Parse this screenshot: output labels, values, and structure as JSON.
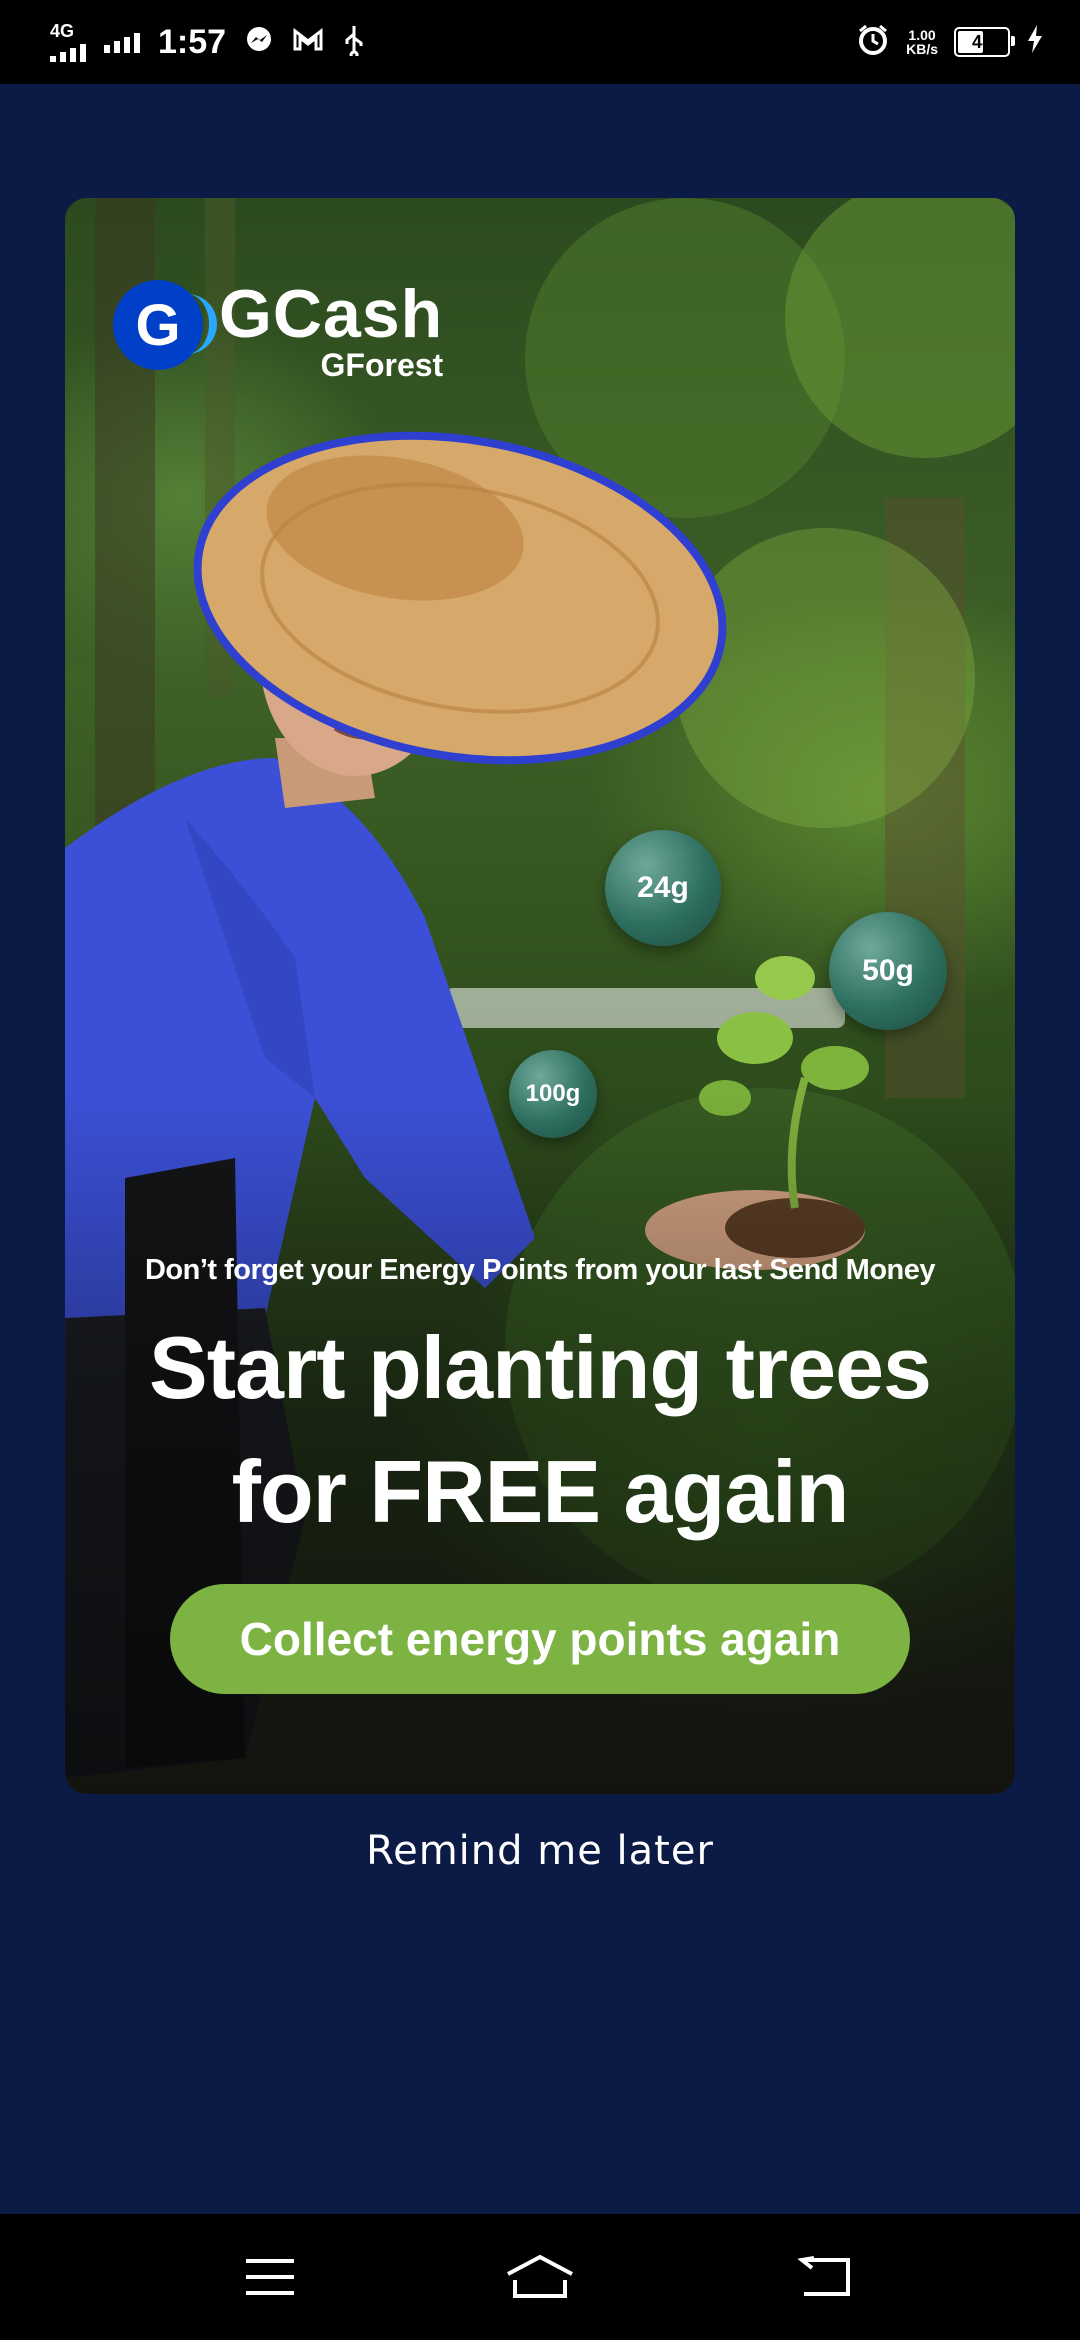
{
  "status_bar": {
    "network": "4G",
    "time": "1:57",
    "speed_value": "1.00",
    "speed_unit": "KB/s",
    "battery": "48"
  },
  "promo": {
    "brand": "GCash",
    "brand_sub": "GForest",
    "logo_letter": "G",
    "energy_bubbles": [
      "24g",
      "50g",
      "100g"
    ],
    "subline": "Don’t forget your Energy Points from your last Send Money",
    "headline_line1": "Start planting trees",
    "headline_line2": "for FREE again",
    "cta_label": "Collect energy points again",
    "cta_color": "#7cb342"
  },
  "remind_label": "Remind me later",
  "nav": {
    "icons": [
      "menu-icon",
      "home-icon",
      "back-icon"
    ]
  },
  "colors": {
    "background": "#0b1b45",
    "accent_green": "#7cb342",
    "shirt_blue": "#3b50d6"
  }
}
